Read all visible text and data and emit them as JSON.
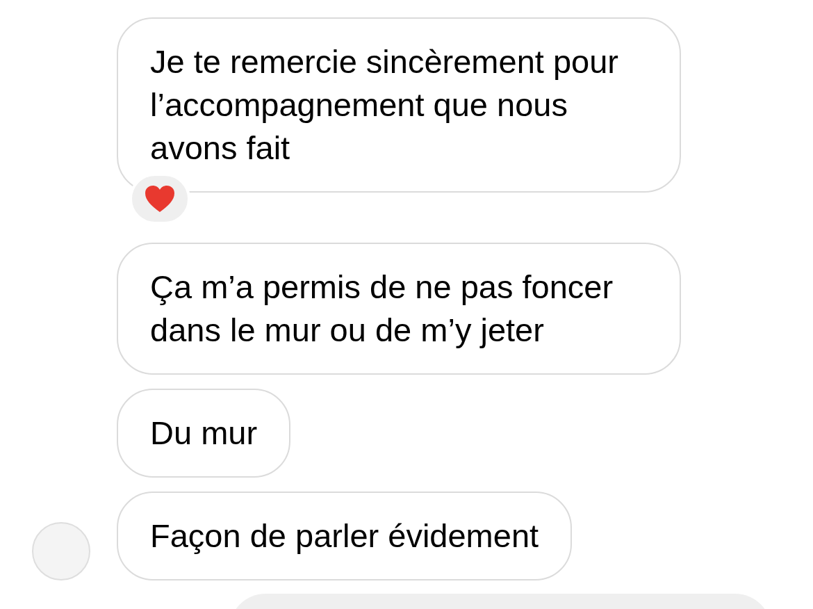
{
  "messages": [
    {
      "kind": "incoming",
      "text": "Je te remercie sincèrement pour l’accompagnement que nous avons fait",
      "reacted": true,
      "show_avatar": false
    },
    {
      "kind": "incoming",
      "text": "Ça m’a permis de ne pas foncer dans le mur ou de m’y jeter",
      "show_avatar": false
    },
    {
      "kind": "incoming",
      "text": "Du mur",
      "show_avatar": false
    },
    {
      "kind": "incoming",
      "text": "Façon de parler évidement",
      "show_avatar": true
    },
    {
      "kind": "outgoing"
    }
  ]
}
